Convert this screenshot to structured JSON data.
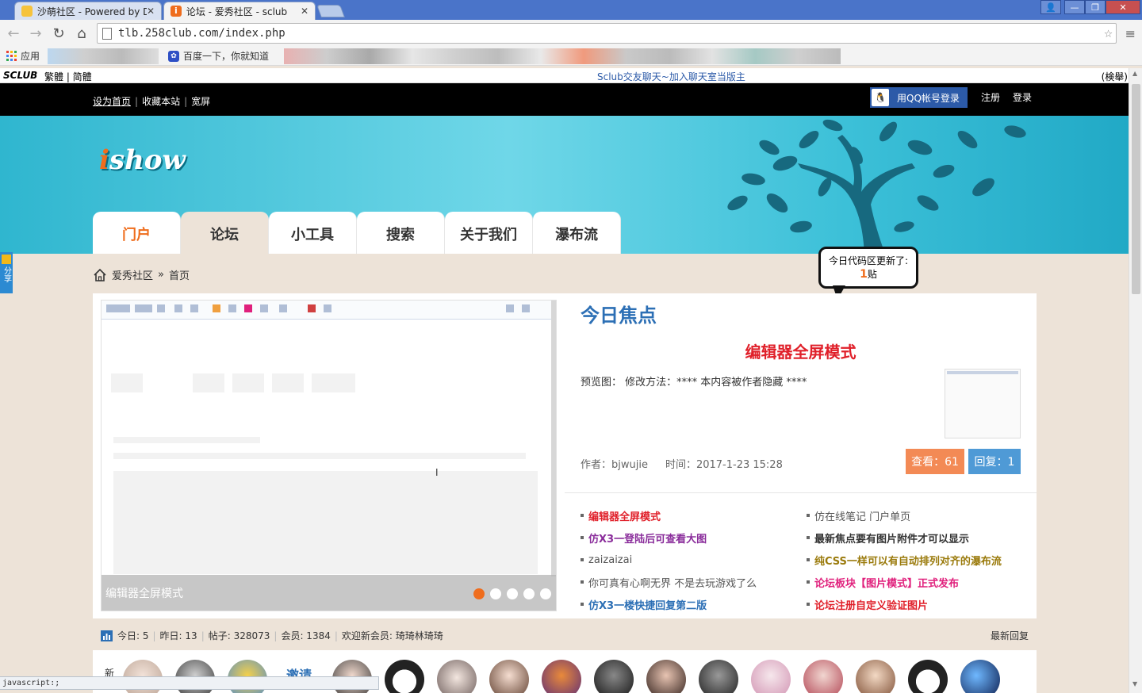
{
  "browser": {
    "tabs": [
      {
        "label": "沙萌社区 - Powered by D",
        "active": false
      },
      {
        "label": "论坛 - 爱秀社区 - sclub",
        "active": true
      }
    ],
    "url": "tlb.258club.com/index.php",
    "bookmarks": {
      "apps_label": "应用",
      "baidu_label": "百度一下，你就知道"
    },
    "status_text": "javascript:;"
  },
  "sitebar": {
    "logo": "SCLUB",
    "links": "繁體 | 简體",
    "center_text": "Sclub交友聊天~加入聊天室当版主",
    "right_text": "(検舉)"
  },
  "topnav": {
    "set_home": "设为首页",
    "bookmark": "收藏本站",
    "wide": "宽屏",
    "qq_login": "用QQ帐号登录",
    "register": "注册",
    "login": "登录"
  },
  "banner": {
    "logo": "ishow",
    "tabs": [
      "门户",
      "论坛",
      "小工具",
      "搜索",
      "关于我们",
      "瀑布流"
    ]
  },
  "breadcrumb": {
    "site": "爱秀社区",
    "sep": "»",
    "page": "首页"
  },
  "bubble": {
    "line1": "今日代码区更新了:",
    "count": "1",
    "unit": "贴"
  },
  "share": "分享",
  "slider": {
    "caption": "编辑器全屏模式",
    "slide_count": 5,
    "active_slide": 1
  },
  "focus": {
    "title": "今日焦点",
    "headline": "编辑器全屏模式",
    "desc": "预览图： 修改方法：**** 本内容被作者隐藏 ****",
    "author": "作者：bjwujie",
    "time": "时间：2017-1-23 15:28",
    "views": "查看：61",
    "replies": "回复：1"
  },
  "list_left": [
    {
      "text": "编辑器全屏模式",
      "style": "red"
    },
    {
      "text": "仿X3一登陆后可查看大图",
      "style": "purple"
    },
    {
      "text": "zaizaizai",
      "style": "gray"
    },
    {
      "text": "你可真有心啊无界 不是去玩游戏了么",
      "style": "gray"
    },
    {
      "text": "仿X3一楼快捷回复第二版",
      "style": "blue"
    }
  ],
  "list_right": [
    {
      "text": "仿在线笔记 门户单页",
      "style": "gray"
    },
    {
      "text": "最新焦点要有图片附件才可以显示",
      "style": "dark"
    },
    {
      "text": "纯CSS一样可以有自动排列对齐的瀑布流",
      "style": "olive"
    },
    {
      "text": "论坛板块【图片模式】正式发布",
      "style": "pink"
    },
    {
      "text": "论坛注册自定义验证图片",
      "style": "red"
    }
  ],
  "stats": {
    "today": "今日: 5",
    "yesterday": "昨日: 13",
    "posts": "帖子: 328073",
    "members": "会员: 1384",
    "welcome": "欢迎新会员:",
    "new_member": "琦琦林琦琦",
    "latest_reply": "最新回复"
  },
  "avatars": {
    "new_tag": "新",
    "invite": "邀请"
  },
  "colors": {
    "accent_orange": "#ef6d1d",
    "link_blue": "#2c6fb5",
    "headline_red": "#e0202a",
    "banner_teal": "#2fb6cf"
  }
}
